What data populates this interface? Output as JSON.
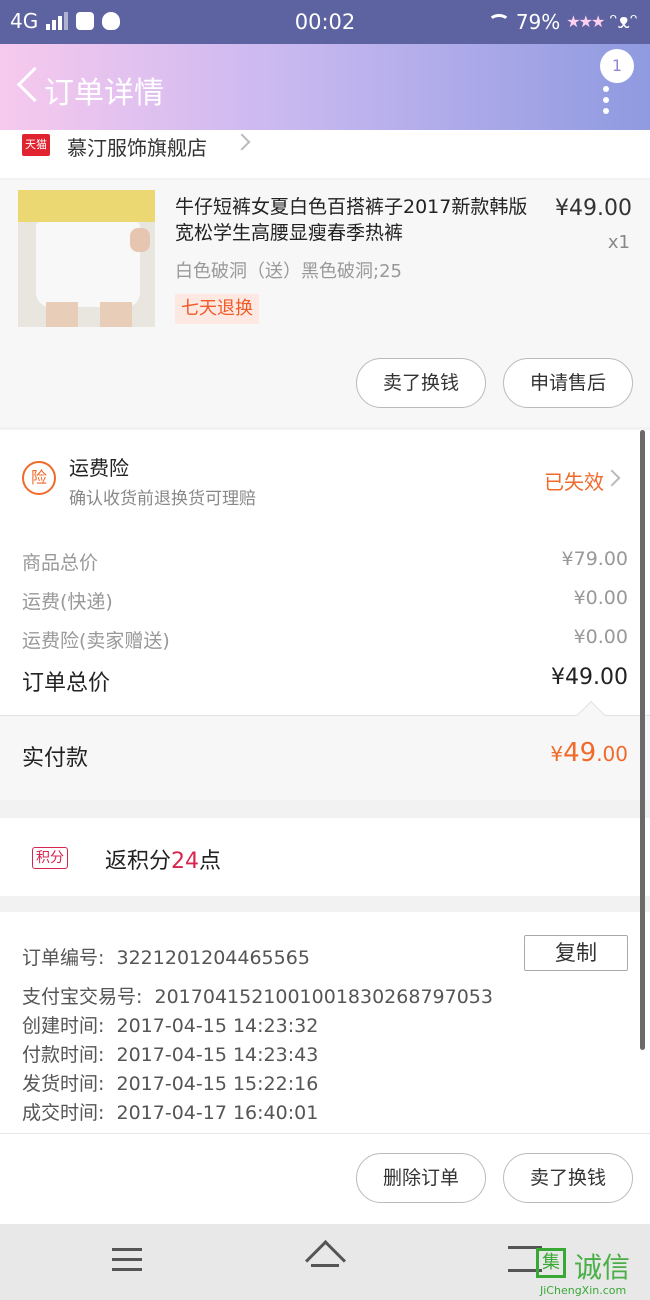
{
  "status_bar": {
    "network": "4G",
    "time": "00:02",
    "battery": "79%"
  },
  "header": {
    "title": "订单详情",
    "message_count": "1"
  },
  "shop": {
    "badge": "天猫",
    "name": "慕汀服饰旗舰店"
  },
  "product": {
    "title": "牛仔短裤女夏白色百搭裤子2017新款韩版宽松学生高腰显瘦春季热裤",
    "price": "¥49.00",
    "quantity": "x1",
    "sku": "白色破洞（送）黑色破洞;25",
    "tag": "七天退换",
    "buttons": {
      "sell": "卖了换钱",
      "after_sale": "申请售后"
    }
  },
  "insurance": {
    "icon_text": "险",
    "title": "运费险",
    "subtitle": "确认收货前退换货可理赔",
    "status": "已失效"
  },
  "summary": {
    "rows": [
      {
        "label": "商品总价",
        "value": "¥79.00"
      },
      {
        "label": "运费(快递)",
        "value": "¥0.00"
      },
      {
        "label": "运费险(卖家赠送)",
        "value": "¥0.00"
      }
    ],
    "total_label": "订单总价",
    "total_value": "¥49.00"
  },
  "paid": {
    "label": "实付款",
    "currency": "¥",
    "integer": "49",
    "decimal": ".00"
  },
  "points": {
    "tag": "积分",
    "prefix": "返积分",
    "count": "24",
    "suffix": "点"
  },
  "order_info": {
    "copy_button": "复制",
    "rows": [
      {
        "label": "订单编号:",
        "value": "3221201204465565"
      },
      {
        "label": "支付宝交易号:",
        "value": "2017041521001001830268797053"
      },
      {
        "label": "创建时间:",
        "value": "2017-04-15 14:23:32"
      },
      {
        "label": "付款时间:",
        "value": "2017-04-15 14:23:43"
      },
      {
        "label": "发货时间:",
        "value": "2017-04-15 15:22:16"
      },
      {
        "label": "成交时间:",
        "value": "2017-04-17 16:40:01"
      }
    ]
  },
  "actions": {
    "delete": "删除订单",
    "sell": "卖了换钱"
  },
  "watermark": {
    "icon": "集",
    "text": "诚信",
    "url": "JiChengXin.com"
  }
}
